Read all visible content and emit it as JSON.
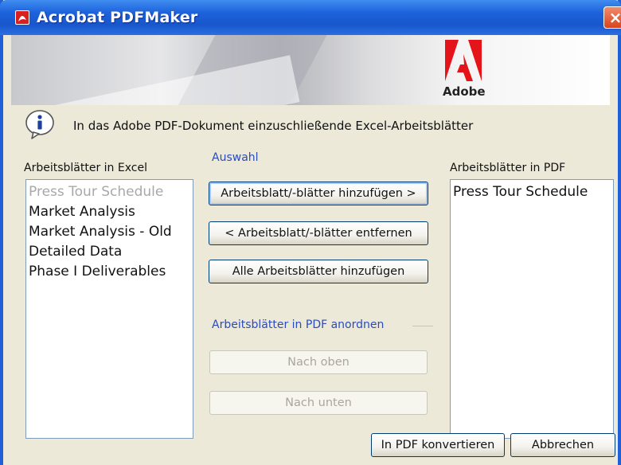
{
  "window": {
    "title": "Acrobat PDFMaker",
    "close_label": "×"
  },
  "banner": {
    "brand": "Adobe"
  },
  "info": {
    "text": "In das Adobe PDF-Dokument einzuschließende Excel-Arbeitsblätter"
  },
  "excel_list": {
    "label": "Arbeitsblätter in Excel",
    "items": [
      {
        "text": "Press Tour Schedule",
        "state": "disabled"
      },
      {
        "text": "Market Analysis",
        "state": "normal"
      },
      {
        "text": "Market Analysis - Old",
        "state": "normal"
      },
      {
        "text": "Detailed Data",
        "state": "normal"
      },
      {
        "text": "Phase I Deliverables",
        "state": "normal"
      }
    ]
  },
  "selection": {
    "group_label": "Auswahl",
    "add_label": "Arbeitsblatt/-blätter hinzufügen  >",
    "remove_label": "<  Arbeitsblatt/-blätter entfernen",
    "add_all_label": "Alle Arbeitsblätter hinzufügen"
  },
  "order": {
    "group_label": "Arbeitsblätter in PDF anordnen",
    "up_label": "Nach oben",
    "down_label": "Nach unten"
  },
  "pdf_list": {
    "label": "Arbeitsblätter in PDF",
    "items": [
      {
        "text": "Press Tour Schedule"
      }
    ]
  },
  "footer": {
    "convert_label": "In PDF konvertieren",
    "cancel_label": "Abbrechen"
  },
  "colors": {
    "titlebar": "#1e63dc",
    "dialog_bg": "#ece9d8",
    "group_label": "#2a4cbc",
    "adobe_red": "#e4141b"
  }
}
